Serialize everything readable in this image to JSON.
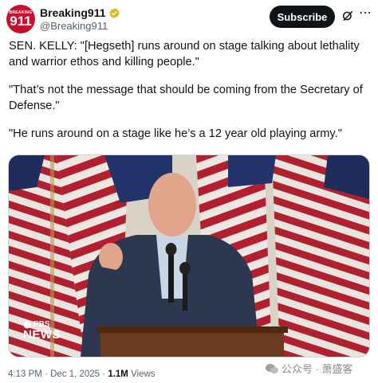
{
  "author": {
    "display_name": "Breaking911",
    "handle": "@Breaking911",
    "verified": true,
    "avatar_text_small": "BREAKING",
    "avatar_text_big": "911"
  },
  "actions": {
    "subscribe_label": "Subscribe",
    "grok_icon": "grok-icon",
    "more_icon": "more-icon"
  },
  "tweet": {
    "paragraphs": [
      "SEN. KELLY: \"[Hegseth] runs around on stage talking about lethality and warrior ethos and killing people.\"",
      "\"That’s not the message that should be coming from the Secretary of Defense.\"",
      "\"He runs around on a stage like he’s a 12 year old playing army.\""
    ]
  },
  "media": {
    "logo_top": "PBS",
    "logo_bottom": "NEWS"
  },
  "meta": {
    "time": "4:13 PM",
    "date": "Dec 1, 2025",
    "views_count": "1.1M",
    "views_label": "Views"
  },
  "watermark": {
    "text": "公众号 · 萧盛客"
  },
  "colors": {
    "accent": "#0f1419",
    "verified_badge": "#e2b719",
    "brand_red": "#c8102e"
  }
}
